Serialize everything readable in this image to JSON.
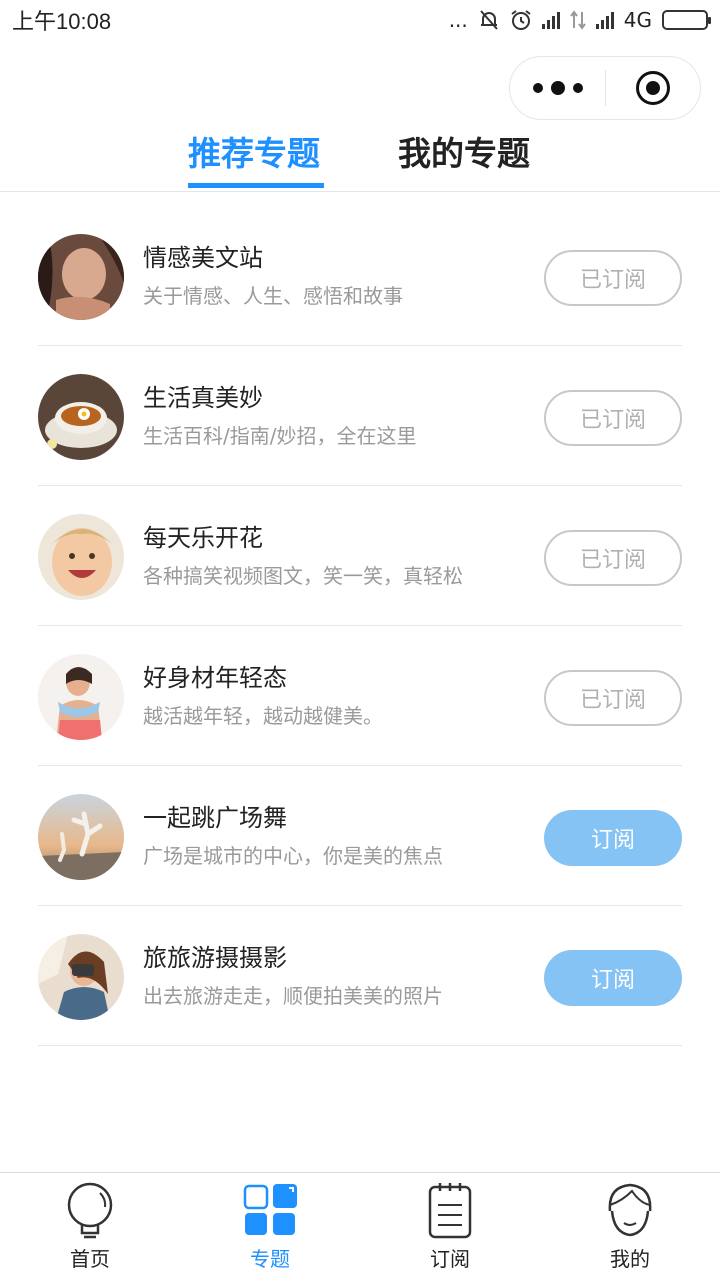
{
  "status_bar": {
    "time": "上午10:08",
    "dots": "...",
    "network": "4G"
  },
  "tabs": [
    {
      "label": "推荐专题",
      "active": true
    },
    {
      "label": "我的专题",
      "active": false
    }
  ],
  "topics": [
    {
      "title": "情感美文站",
      "desc": "关于情感、人生、感悟和故事",
      "button": "已订阅",
      "subscribed": true
    },
    {
      "title": "生活真美妙",
      "desc": "生活百科/指南/妙招，全在这里",
      "button": "已订阅",
      "subscribed": true
    },
    {
      "title": "每天乐开花",
      "desc": "各种搞笑视频图文，笑一笑，真轻松",
      "button": "已订阅",
      "subscribed": true
    },
    {
      "title": "好身材年轻态",
      "desc": "越活越年轻，越动越健美。",
      "button": "已订阅",
      "subscribed": true
    },
    {
      "title": "一起跳广场舞",
      "desc": "广场是城市的中心，你是美的焦点",
      "button": "订阅",
      "subscribed": false
    },
    {
      "title": "旅旅游摄摄影",
      "desc": "出去旅游走走，顺便拍美美的照片",
      "button": "订阅",
      "subscribed": false
    }
  ],
  "tabbar": [
    {
      "label": "首页",
      "icon": "lightbulb-icon",
      "active": false
    },
    {
      "label": "专题",
      "icon": "grid-icon",
      "active": true
    },
    {
      "label": "订阅",
      "icon": "notepad-icon",
      "active": false
    },
    {
      "label": "我的",
      "icon": "face-icon",
      "active": false
    }
  ],
  "colors": {
    "accent": "#1e90ff",
    "subscribe_button": "#86c3f5",
    "subscribed_border": "#c8c8c8"
  }
}
